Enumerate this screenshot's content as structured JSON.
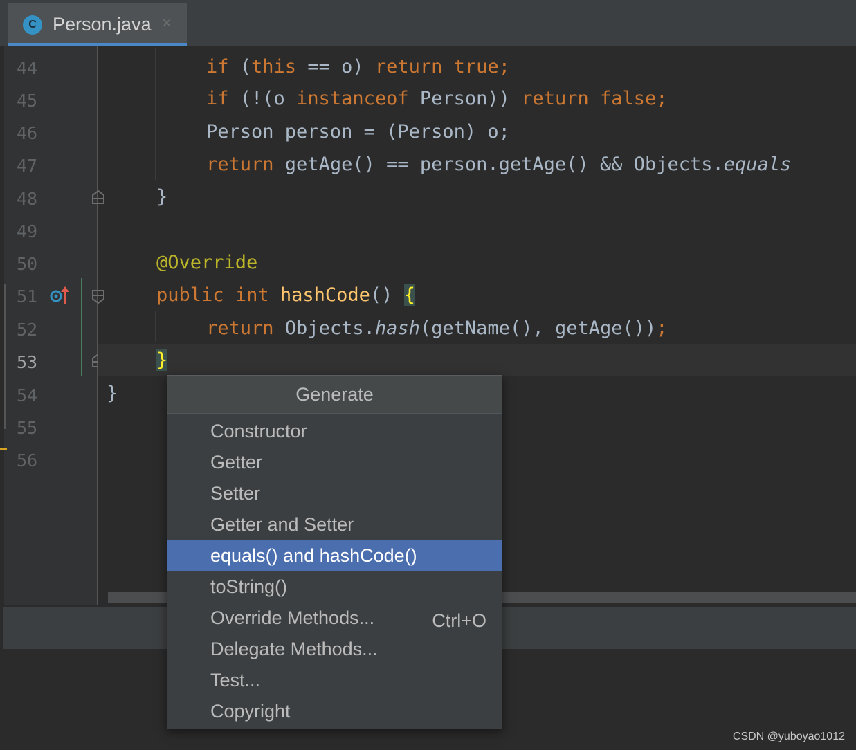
{
  "tab": {
    "icon_letter": "C",
    "title": "Person.java",
    "close": "×"
  },
  "gutter": {
    "line_numbers": [
      "44",
      "45",
      "46",
      "47",
      "48",
      "49",
      "50",
      "51",
      "52",
      "53",
      "54",
      "55",
      "56"
    ],
    "current_line": "53"
  },
  "code": {
    "l44": {
      "kw1": "if",
      "p1": " (",
      "kw2": "this",
      "p2": " == o) ",
      "kw3": "return",
      "p3": " ",
      "kw4": "true",
      "p4": ";"
    },
    "l45": {
      "kw1": "if",
      "p1": " (!(o ",
      "kw2": "instanceof",
      "p2": " Person)) ",
      "kw3": "return",
      "p3": " ",
      "kw4": "false",
      "p4": ";"
    },
    "l46": {
      "text": "Person person = (Person) o;"
    },
    "l47": {
      "kw1": "return",
      "p1": " getAge() == person.getAge() && Objects.",
      "it": "equals"
    },
    "l48": {
      "text": "}"
    },
    "l50": {
      "ann": "@Override"
    },
    "l51": {
      "kw1": "public",
      "p1": " ",
      "kw2": "int",
      "p2": " ",
      "m": "hashCode",
      "p3": "() ",
      "brace": "{"
    },
    "l52": {
      "kw1": "return",
      "p1": " Objects.",
      "it": "hash",
      "p2": "(getName(), getAge())",
      "p3": ";"
    },
    "l53": {
      "brace": "}"
    },
    "l54": {
      "text": "}"
    }
  },
  "popup": {
    "title": "Generate",
    "items": [
      {
        "label": "Constructor",
        "shortcut": ""
      },
      {
        "label": "Getter",
        "shortcut": ""
      },
      {
        "label": "Setter",
        "shortcut": ""
      },
      {
        "label": "Getter and Setter",
        "shortcut": ""
      },
      {
        "label": "equals() and hashCode()",
        "shortcut": ""
      },
      {
        "label": "toString()",
        "shortcut": ""
      },
      {
        "label": "Override Methods...",
        "shortcut": "Ctrl+O"
      },
      {
        "label": "Delegate Methods...",
        "shortcut": ""
      },
      {
        "label": "Test...",
        "shortcut": ""
      },
      {
        "label": "Copyright",
        "shortcut": ""
      }
    ],
    "selected_index": 4
  },
  "watermark": "CSDN @yuboyao1012",
  "colors": {
    "editor_bg": "#2b2b2b",
    "keyword": "#cc7832",
    "annotation": "#bbb529",
    "method_decl": "#ffc66d",
    "selection": "#4b6eaf"
  }
}
